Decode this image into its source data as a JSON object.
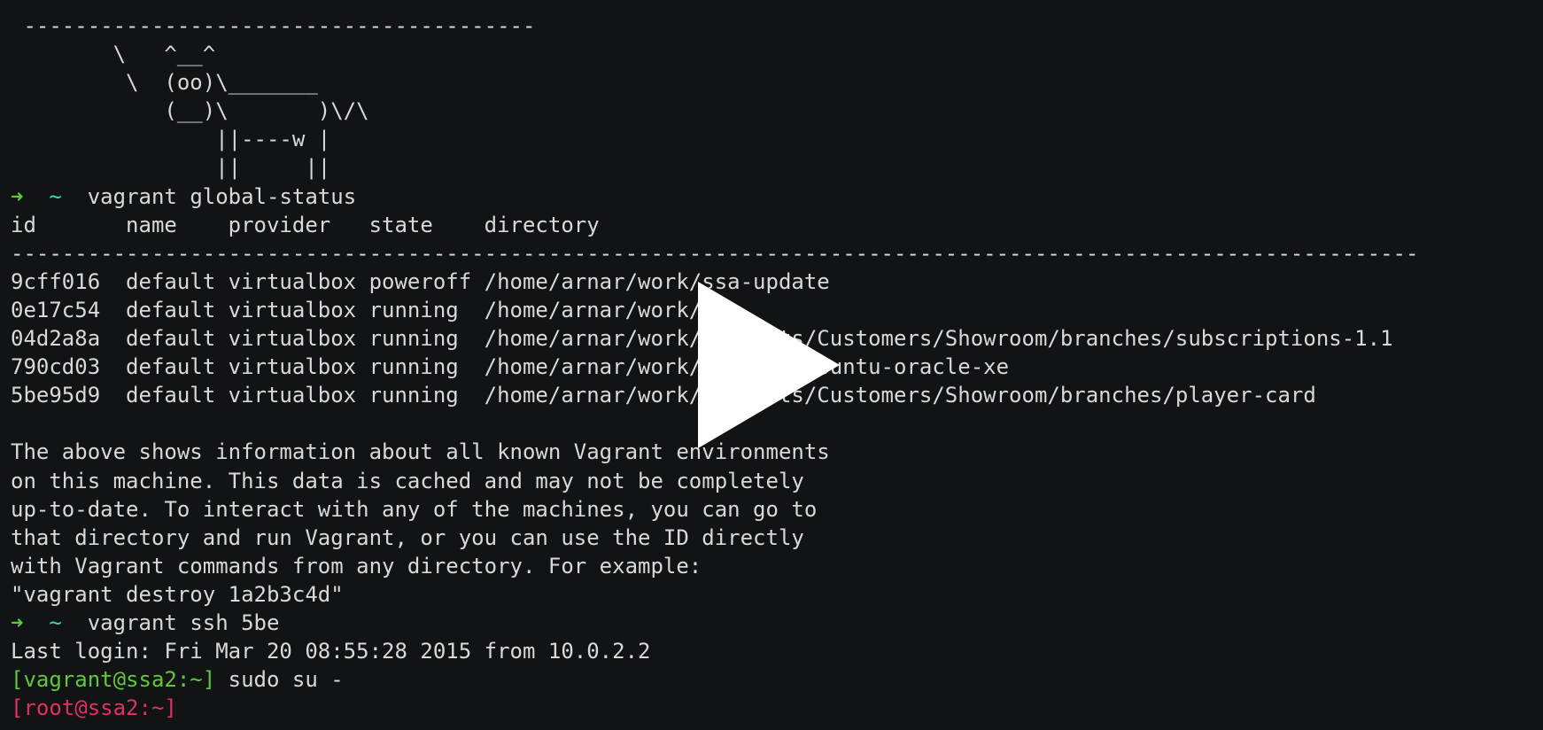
{
  "terminal": {
    "art": [
      " ----------------------------------------",
      "        \\   ^__^",
      "         \\  (oo)\\_______",
      "            (__)\\       )\\/\\",
      "                ||----w |",
      "                ||     ||"
    ],
    "prompt1": {
      "arrow": "➜",
      "dir": "~",
      "command": "vagrant global-status"
    },
    "status_header": "id       name    provider   state    directory",
    "status_separator": "--------------------------------------------------------------------------------------------------------------",
    "status_rows": [
      "9cff016  default virtualbox poweroff /home/arnar/work/ssa-update",
      "0e17c54  default virtualbox running  /home/arnar/work/",
      "04d2a8a  default virtualbox running  /home/arnar/work/projects/Customers/Showroom/branches/subscriptions-1.1",
      "790cd03  default virtualbox running  /home/arnar/work/vagrant/ubuntu-oracle-xe",
      "5be95d9  default virtualbox running  /home/arnar/work/projects/Customers/Showroom/branches/player-card"
    ],
    "info_lines": [
      "The above shows information about all known Vagrant environments",
      "on this machine. This data is cached and may not be completely",
      "up-to-date. To interact with any of the machines, you can go to",
      "that directory and run Vagrant, or you can use the ID directly",
      "with Vagrant commands from any directory. For example:",
      "\"vagrant destroy 1a2b3c4d\""
    ],
    "prompt2": {
      "arrow": "➜",
      "dir": "~",
      "command": "vagrant ssh 5be"
    },
    "last_login": "Last login: Fri Mar 20 08:55:28 2015 from 10.0.2.2",
    "vagrant_prompt": "[vagrant@ssa2:~]",
    "vagrant_command": "sudo su -",
    "root_prompt": "[root@ssa2:~]"
  },
  "overlay": {
    "icon": "play-icon",
    "color": "#ffffff"
  },
  "colors": {
    "background": "#121314",
    "text": "#d9d9d9",
    "arrow": "#5fc93b",
    "tilde": "#3fd3c0",
    "vagrant_prompt": "#5fc93b",
    "root_prompt": "#e0325f"
  }
}
